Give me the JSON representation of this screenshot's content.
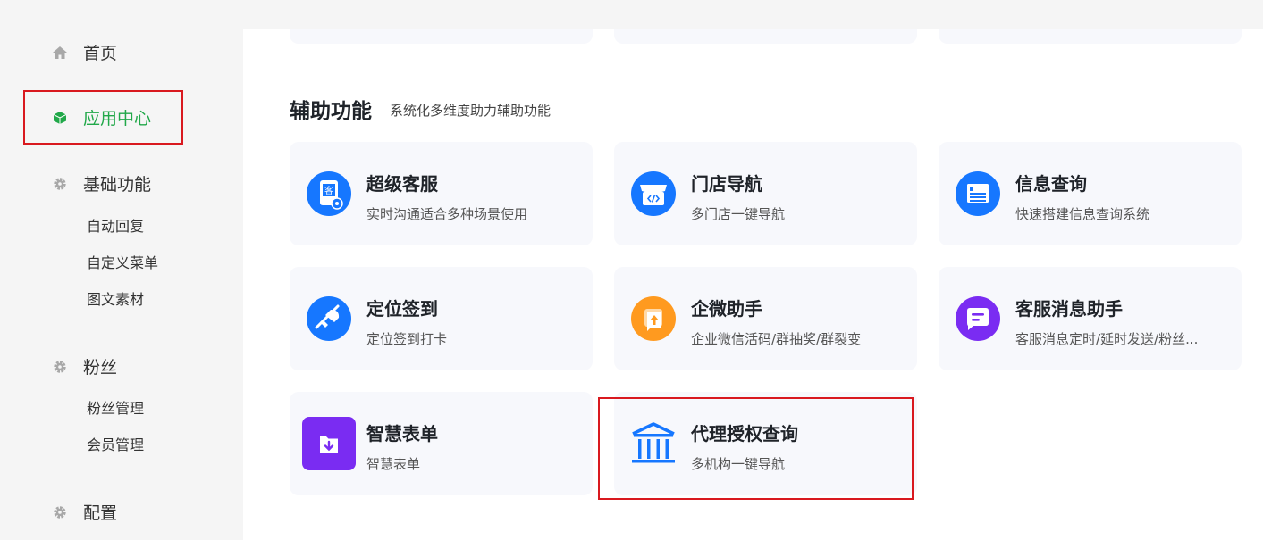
{
  "sidebar": {
    "home": "首页",
    "app_center": "应用中心",
    "basic": {
      "label": "基础功能",
      "items": [
        "自动回复",
        "自定义菜单",
        "图文素材"
      ]
    },
    "fans": {
      "label": "粉丝",
      "items": [
        "粉丝管理",
        "会员管理"
      ]
    },
    "config": "配置"
  },
  "section": {
    "title": "辅助功能",
    "desc": "系统化多维度助力辅助功能"
  },
  "cards": [
    {
      "title": "超级客服",
      "sub": "实时沟通适合多种场景使用"
    },
    {
      "title": "门店导航",
      "sub": "多门店一键导航"
    },
    {
      "title": "信息查询",
      "sub": "快速搭建信息查询系统"
    },
    {
      "title": "定位签到",
      "sub": "定位签到打卡"
    },
    {
      "title": "企微助手",
      "sub": "企业微信活码/群抽奖/群裂变"
    },
    {
      "title": "客服消息助手",
      "sub": "客服消息定时/延时发送/粉丝..."
    },
    {
      "title": "智慧表单",
      "sub": "智慧表单"
    },
    {
      "title": "代理授权查询",
      "sub": "多机构一键导航"
    }
  ],
  "colors": {
    "accent_green": "#21a849",
    "highlight_red": "#d9191f",
    "icon_blue": "#1677ff",
    "icon_orange": "#ff9a1f",
    "icon_purple": "#7a2cf2"
  }
}
